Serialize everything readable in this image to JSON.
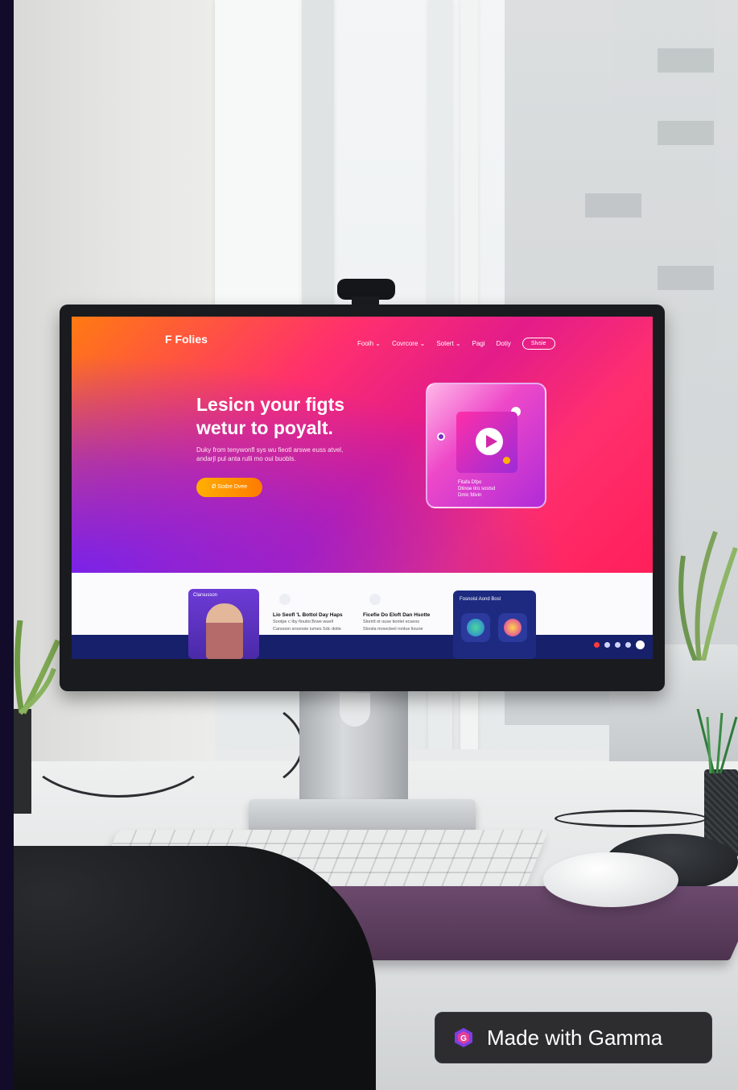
{
  "website": {
    "logo": "F Folies",
    "nav": [
      "Fooih ⌄",
      "Covrcore ⌄",
      "Sotert ⌄",
      "Pagi",
      "Dotiy"
    ],
    "nav_button": "Slvsie",
    "headline_line1": "Lesicn your figts",
    "headline_line2": "wetur to poyalt.",
    "subtext_line1": "Duky from tenywonfl sys wu fieotl arswe euss atvel,",
    "subtext_line2": "andarjl pul anta rulli mo oui buobls.",
    "cta_label": "Ø Sodre Dvee",
    "hero_card_text_line1": "Fitafa Dfpo",
    "hero_card_text_line2": "Dtinoe tiro sostsd",
    "hero_card_text_line3": "Dmic fdivin",
    "photo_card_label": "Clarsusson",
    "features": [
      {
        "title": "Lio Seofl 'L Bottol Day Haps",
        "text_line1": "Sootpe c Iby  fioutio Brwe wuell",
        "text_line2": "Cansoon sroonsie iumes Sdc  doite"
      },
      {
        "title": "Ficefie Do Eloft Dan Hsotte",
        "text_line1": "Slorirtl ot ouse tionlel ecseos",
        "text_line2": "Slsrsla mrsocleel ronlue lioune"
      }
    ],
    "dark_card_title": "Fosnoisl Aond Bosl"
  },
  "badge": {
    "text": "Made with Gamma"
  },
  "colors": {
    "hero_orange": "#ff7a12",
    "hero_pink": "#ff2f6e",
    "hero_purple": "#7a22e8",
    "cta_gold": "#ffb000",
    "navy": "#17206a"
  }
}
